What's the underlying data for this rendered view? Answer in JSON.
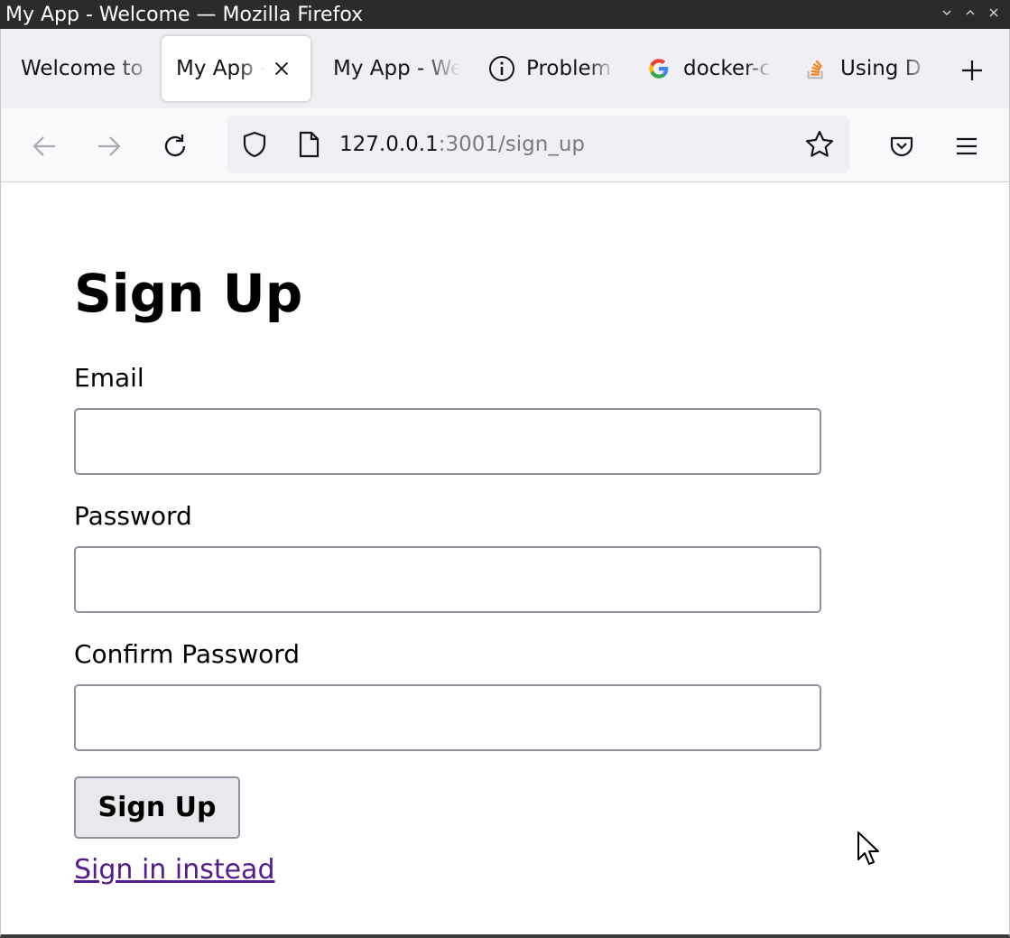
{
  "window": {
    "title": "My App - Welcome — Mozilla Firefox"
  },
  "tabs": [
    {
      "label": "Welcome to",
      "icon": "none"
    },
    {
      "label": "My App - ",
      "icon": "none",
      "active": true
    },
    {
      "label": "My App - We",
      "icon": "none"
    },
    {
      "label": "Problem",
      "icon": "info-icon"
    },
    {
      "label": "docker-c",
      "icon": "google-icon"
    },
    {
      "label": "Using D",
      "icon": "stackoverflow-icon"
    }
  ],
  "navbar": {
    "url_host": "127.0.0.1",
    "url_rest": ":3001/sign_up"
  },
  "form": {
    "title": "Sign Up",
    "email_label": "Email",
    "email_value": "",
    "password_label": "Password",
    "password_value": "",
    "confirm_label": "Confirm Password",
    "confirm_value": "",
    "submit_label": "Sign Up",
    "signin_link": "Sign in instead"
  },
  "colors": {
    "link_visited": "#551a8b",
    "titlebar": "#2b2b2b",
    "tabstrip": "#f0f0f4"
  }
}
